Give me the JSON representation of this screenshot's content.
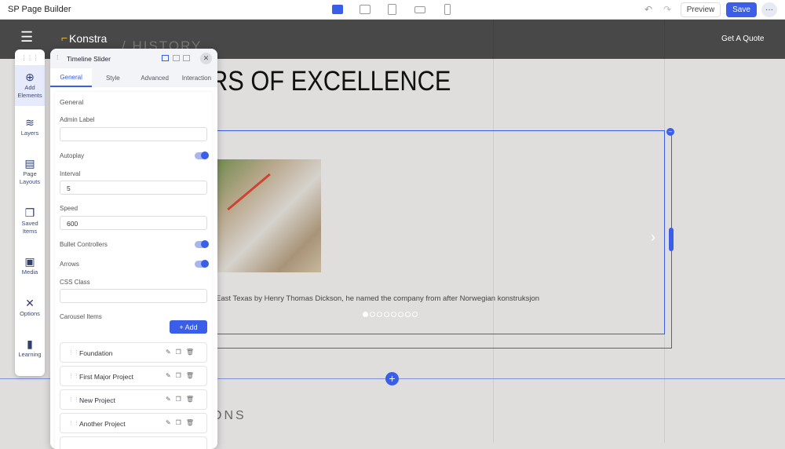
{
  "app": {
    "title": "SP Page Builder",
    "preview": "Preview",
    "save": "Save",
    "more": "···"
  },
  "site": {
    "logo": "Konstra",
    "cta": "Get A Quote",
    "breadcrumb": "/ HISTORY",
    "heading": "RS OF EXCELLENCE",
    "caption": "East Texas by Henry Thomas Dickson, he named the company from after Norwegian konstruksjon",
    "section2": "ONS",
    "slide_count": 8,
    "active_slide": 1
  },
  "sidebar": {
    "items": [
      {
        "label": "Add Elements",
        "icon": "⊕"
      },
      {
        "label": "Layers",
        "icon": "≋"
      },
      {
        "label": "Page Layouts",
        "icon": "▤"
      },
      {
        "label": "Saved Items",
        "icon": "❒"
      },
      {
        "label": "Media",
        "icon": "▣"
      },
      {
        "label": "Options",
        "icon": "✕"
      },
      {
        "label": "Learning",
        "icon": "▮"
      }
    ]
  },
  "panel": {
    "title": "Timeline Slider",
    "tabs": [
      "General",
      "Style",
      "Advanced",
      "Interaction"
    ],
    "section": "General",
    "admin_label": "Admin Label",
    "admin_value": "",
    "autoplay": "Autoplay",
    "interval_label": "Interval",
    "interval": "5",
    "speed_label": "Speed",
    "speed": "600",
    "bullets": "Bullet Controllers",
    "arrows": "Arrows",
    "css_label": "CSS Class",
    "css_value": "",
    "carousel_label": "Carousel Items",
    "add": "+ Add",
    "items": [
      "Foundation",
      "First Major Project",
      "New Project",
      "Another Project"
    ]
  }
}
